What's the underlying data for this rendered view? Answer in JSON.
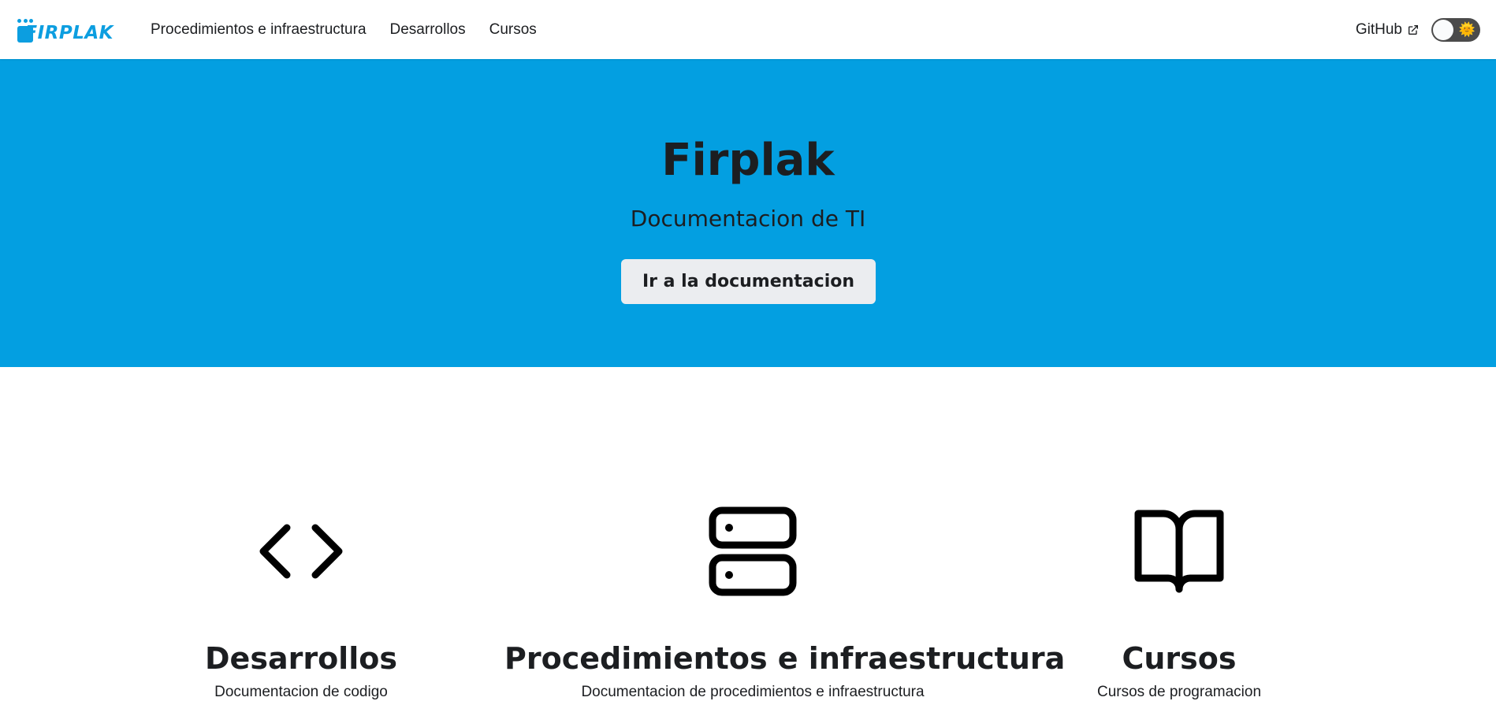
{
  "navbar": {
    "logo_text": "FIRPLAK",
    "links": [
      {
        "label": "Procedimientos e infraestructura"
      },
      {
        "label": "Desarrollos"
      },
      {
        "label": "Cursos"
      }
    ],
    "github_label": "GitHub",
    "theme_toggle_icon": "sun-icon"
  },
  "hero": {
    "title": "Firplak",
    "subtitle": "Documentacion de TI",
    "button_label": "Ir a la documentacion",
    "background_color": "#039fe1"
  },
  "features": [
    {
      "icon": "code-icon",
      "title": "Desarrollos",
      "description": "Documentacion de codigo"
    },
    {
      "icon": "server-icon",
      "title": "Procedimientos e infraestructura",
      "description": "Documentacion de procedimientos e infraestructura"
    },
    {
      "icon": "book-icon",
      "title": "Cursos",
      "description": "Cursos de programacion"
    }
  ]
}
